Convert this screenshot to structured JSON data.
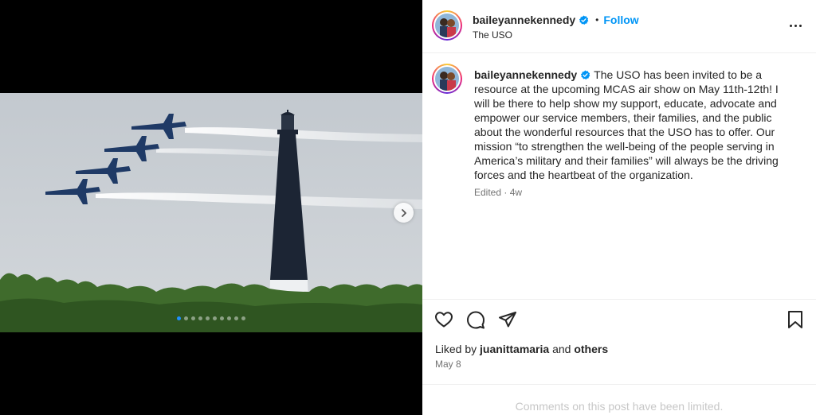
{
  "media": {
    "carousel_total": 10,
    "carousel_active": 1,
    "colors": {
      "sky": "#c9cfd5",
      "tower_dark": "#1c2534",
      "trees": "#3f6b2c",
      "jets": "#1f3a66"
    }
  },
  "post": {
    "author": {
      "username": "baileyannekennedy",
      "verified": true,
      "avatar_icon": "profile-photo"
    },
    "follow_label": "Follow",
    "separator": "•",
    "location": "The USO",
    "caption": "The USO has been invited to be a resource at the upcoming MCAS air show on May 11th-12th! I will be there to help show my support, educate, advocate and empower our service members, their families, and the public about the wonderful resources that the USO has to offer. Our mission “to strengthen the well-being of the people serving in America’s military and their families” will always be the driving forces and the heartbeat of the organization.",
    "edited_meta": "Edited · 4w",
    "likes": {
      "prefix": "Liked by ",
      "user": "juanittamaria",
      "middle": " and ",
      "others": "others"
    },
    "date": "May 8",
    "comments_notice": "Comments on this post have been limited."
  },
  "icons": {
    "like": "heart-outline-icon",
    "comment": "comment-bubble-icon",
    "share": "paper-plane-icon",
    "save": "bookmark-icon",
    "more": "more-horizontal-icon",
    "next": "chevron-right-icon",
    "verified": "verified-badge-icon"
  },
  "colors": {
    "accent": "#0095f6",
    "verified": "#0095f6",
    "text": "#262626",
    "muted": "#737373"
  }
}
